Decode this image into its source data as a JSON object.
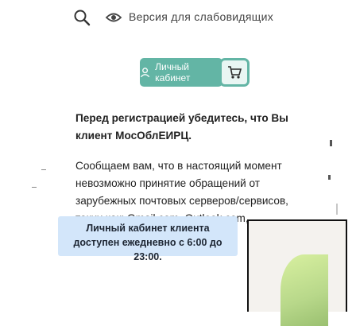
{
  "header": {
    "search_icon": "search-icon",
    "version_icon": "eye-icon",
    "version_link": "Версия для слабовидящих"
  },
  "cabinet_button": {
    "label": "Личный кабинет",
    "icon": "user-icon"
  },
  "cart_button": {
    "icon": "cart-icon"
  },
  "message": {
    "title": "Перед регистрацией убедитесь, что Вы клиент МосОблЕИРЦ.",
    "body": "Сообщаем вам, что в настоящий момент невозможно принятие обращений от зарубежных почтовых серверов/сервисов, таких как: Gmail.com, Outlook.com, iCloud.com, Yahoo.com, и т.п."
  },
  "notice": {
    "text": "Личный кабинет клиента доступен ежедневно с 6:00 до 23:00."
  },
  "colors": {
    "accent": "#63b5a5",
    "notice_bg": "#d3e6fa"
  }
}
